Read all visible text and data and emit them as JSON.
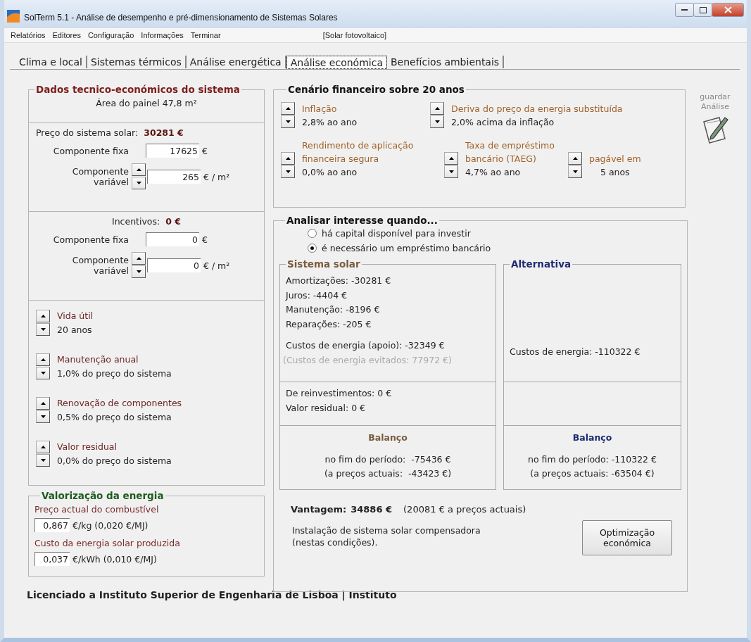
{
  "window": {
    "title": "SolTerm 5.1 - Análise de desempenho e pré-dimensionamento de Sistemas Solares"
  },
  "menu": [
    "Relatórios",
    "Editores",
    "Configuração",
    "Informações",
    "Terminar"
  ],
  "mode": "[Solar fotovoltaico]",
  "tabs": [
    {
      "label": "Clima e local",
      "selected": false
    },
    {
      "label": "Sistemas térmicos",
      "selected": false
    },
    {
      "label": "Análise energética",
      "selected": false
    },
    {
      "label": "Análise económica",
      "selected": true
    },
    {
      "label": "Benefícios ambientais",
      "selected": false
    }
  ],
  "system_data": {
    "title": "Dados tecnico-económicos do sistema",
    "panel_area": "Área do painel 47,8 m²",
    "price": {
      "label": "Preço do sistema solar:",
      "value": "30281 €",
      "fixed": {
        "label": "Componente fixa",
        "value": "17625",
        "unit": "€"
      },
      "variable": {
        "label": "Componente variável",
        "value": "265",
        "unit": "€ / m²"
      }
    },
    "incentives": {
      "label": "Incentivos:",
      "value": "0 €",
      "fixed": {
        "label": "Componente fixa",
        "value": "0",
        "unit": "€"
      },
      "variable": {
        "label": "Componente variável",
        "value": "0",
        "unit": "€ / m²"
      }
    },
    "parameters": [
      {
        "label": "Vida útil",
        "value": "20 anos"
      },
      {
        "label": "Manutenção anual",
        "value": "1,0% do preço do sistema"
      },
      {
        "label": "Renovação de componentes",
        "value": "0,5% do preço do sistema"
      },
      {
        "label": "Valor residual",
        "value": "0,0% do preço do sistema"
      }
    ]
  },
  "energy_valuation": {
    "title": "Valorização da energia",
    "fields": [
      {
        "label": "Preço actual do combustível",
        "value": "0,867",
        "unit": "€/kg  (0,020 €/MJ)"
      },
      {
        "label": "Custo da energia solar produzida",
        "value": "0,037",
        "unit": "€/kWh (0,010 €/MJ)"
      }
    ]
  },
  "financial": {
    "title": "Cenário financeiro sobre 20 anos",
    "rows": [
      {
        "items": [
          {
            "label": "Inflação",
            "value": "2,8% ao ano"
          },
          {
            "label": "Deriva do preço da energia substituída",
            "value": "2,0% acima da inflação"
          }
        ]
      },
      {
        "items": [
          {
            "label": "Rendimento de aplicação financeira segura",
            "value": "0,0% ao ano"
          },
          {
            "label": "Taxa de empréstimo bancário (TAEG)",
            "value": "4,7% ao ano"
          },
          {
            "label": "pagável em",
            "value": "5 anos"
          }
        ]
      }
    ]
  },
  "save": {
    "label": "guardar Análise"
  },
  "analysis": {
    "title": "Analisar interesse quando...",
    "options": [
      {
        "label": "há capital disponível para investir",
        "selected": false
      },
      {
        "label": "é necessário um empréstimo bancário",
        "selected": true
      }
    ],
    "solar": {
      "title": "Sistema solar",
      "costs": [
        "Amortizações: -30281 €",
        "Juros: -4404 €",
        "Manutenção: -8196 €",
        "Reparações: -205 €"
      ],
      "energy_cost": "Custos de energia (apoio): -32349 €",
      "avoided": "(Custos de energia evitados: 77972 €)",
      "other": [
        "De reinvestimentos: 0 €",
        "Valor residual: 0 €"
      ],
      "balance_title": "Balanço",
      "balance": [
        "no fim do período:  -75436 €",
        "(a preços actuais:  -43423 €)"
      ]
    },
    "alternative": {
      "title": "Alternativa",
      "energy_cost": "Custos de energia: -110322 €",
      "balance_title": "Balanço",
      "balance": [
        "no fim do período: -110322 €",
        "(a preços actuais: -63504 €)"
      ]
    },
    "advantage": {
      "label": "Vantagem:",
      "value": "34886 €",
      "note": "(20081 € a preços actuais)"
    },
    "conclusion": "Instalação de sistema solar compensadora (nestas condições).",
    "button": "Optimização económica"
  },
  "license": "Licenciado a Instituto Superior de Engenharia de Lisboa | Instituto"
}
